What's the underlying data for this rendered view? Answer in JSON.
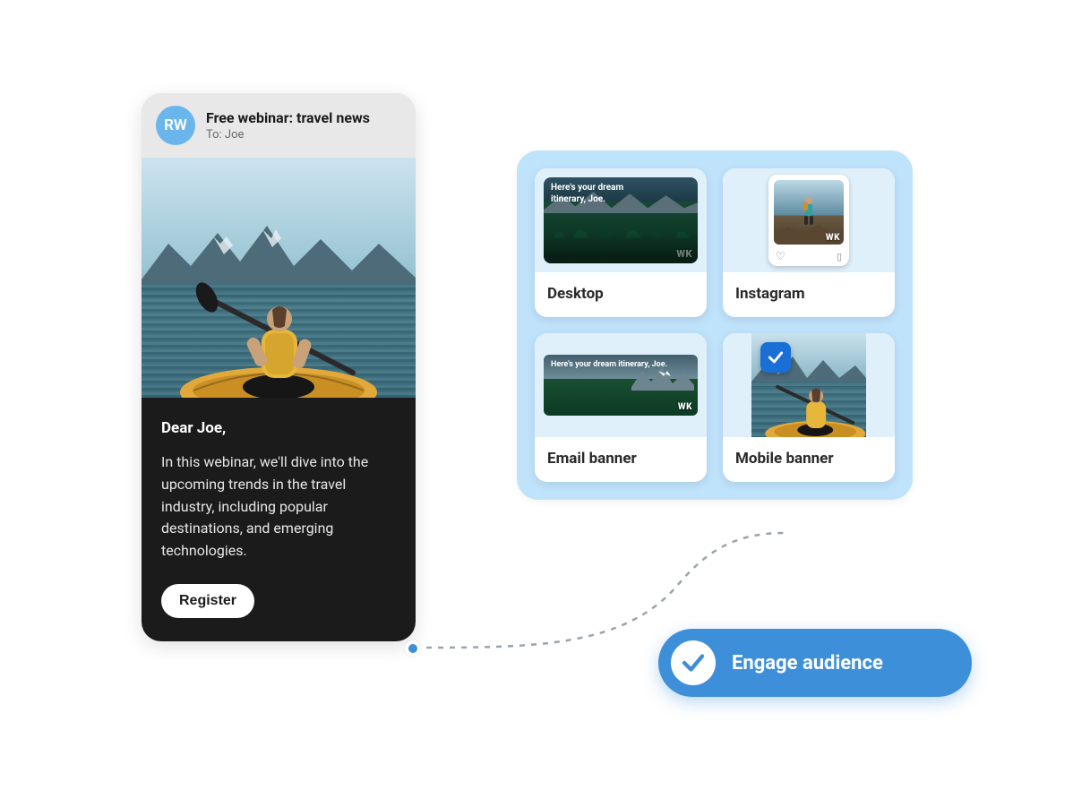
{
  "email": {
    "avatar_initials": "RW",
    "subject": "Free webinar: travel news",
    "to_line": "To: Joe",
    "greeting": "Dear Joe,",
    "body": "In this webinar, we'll dive into the upcoming trends in the travel industry, including popular destinations, and emerging technologies.",
    "cta": "Register"
  },
  "assets": {
    "desktop": {
      "label": "Desktop",
      "overlay_text": "Here's your dream itinerary, Joe.",
      "watermark": "WK"
    },
    "instagram": {
      "label": "Instagram",
      "watermark": "WK"
    },
    "email_banner": {
      "label": "Email banner",
      "overlay_text": "Here's your dream itinerary, Joe.",
      "watermark": "WK"
    },
    "mobile_banner": {
      "label": "Mobile banner",
      "selected": true
    }
  },
  "engage": {
    "label": "Engage audience"
  }
}
